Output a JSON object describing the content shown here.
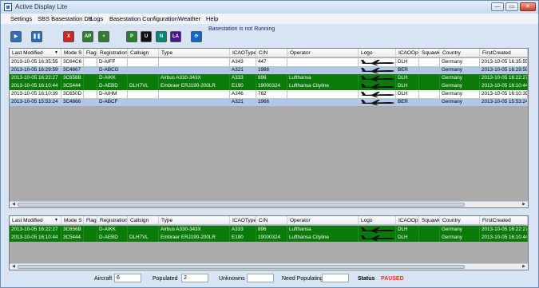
{
  "window": {
    "title": "Active Display Lite",
    "buttons": [
      "—",
      "▭",
      "✕"
    ]
  },
  "menu": [
    "Settings",
    "SBS Basestation DB",
    "Logs",
    "Basestation Configuration",
    "Weather",
    "Help"
  ],
  "toolbar": {
    "status_message": "Basestation is not Running",
    "buttons": [
      {
        "name": "start",
        "label": "▶",
        "color": "#2f6db5"
      },
      {
        "name": "pause",
        "label": "❚❚",
        "color": "#2f6db5"
      },
      {
        "name": "delete",
        "label": "X",
        "color": "#c62828"
      },
      {
        "name": "ap",
        "label": "AP",
        "color": "#2e7d32"
      },
      {
        "name": "add",
        "label": "+",
        "color": "#2e7d32"
      },
      {
        "name": "p",
        "label": "P",
        "color": "#2e7d32"
      },
      {
        "name": "u",
        "label": "U",
        "color": "#111111"
      },
      {
        "name": "n",
        "label": "N",
        "color": "#00897b"
      },
      {
        "name": "la",
        "label": "LA",
        "color": "#4a148c"
      },
      {
        "name": "refresh",
        "label": "⟳",
        "color": "#1565c0"
      }
    ]
  },
  "columns": [
    "Last Modified",
    "Mode S",
    "Flag",
    "Registration",
    "Callsign",
    "Type",
    "ICAOType",
    "C/N",
    "Operator",
    "Logo",
    "ICAOOp",
    "Squawk",
    "Country",
    "FirstCreated"
  ],
  "sort_indicator": "▼",
  "top_rows": [
    {
      "style": "white",
      "cells": [
        "2013-10-05 16:35:55",
        "3C64C6",
        "",
        "D-AIFF",
        "",
        "",
        "A343",
        "447",
        "",
        "",
        "DLH",
        "",
        "Germany",
        "2013-10-05 16:35:55"
      ]
    },
    {
      "style": "blue",
      "cells": [
        "2013-10-05 16:29:59",
        "3C4867",
        "",
        "D-ABCG",
        "",
        "",
        "A321",
        "1988",
        "",
        "",
        "BER",
        "",
        "Germany",
        "2013-10-05 16:29:59"
      ]
    },
    {
      "style": "green",
      "cells": [
        "2013-10-05 16:22:27",
        "3C656B",
        "",
        "D-AIKK",
        "",
        "Airbus A330-343X",
        "A333",
        "896",
        "Lufthansa",
        "",
        "DLH",
        "",
        "Germany",
        "2013-10-05 16:22:27"
      ]
    },
    {
      "style": "green",
      "cells": [
        "2013-10-05 16:10:44",
        "3C5444",
        "",
        "D-AEBD",
        "DLH7VL",
        "Embraer ERJ190-200LR",
        "E190",
        "19000324",
        "Lufthansa Cityline",
        "",
        "DLH",
        "",
        "Germany",
        "2013-10-05 16:10:44"
      ]
    },
    {
      "style": "white",
      "cells": [
        "2013-10-05 16:10:39",
        "3C650D",
        "",
        "D-AIHM",
        "",
        "",
        "A346",
        "762",
        "",
        "",
        "DLH",
        "",
        "Germany",
        "2013-10-05 16:10:39"
      ]
    },
    {
      "style": "blue",
      "cells": [
        "2013-10-05 15:53:24",
        "3C4866",
        "",
        "D-ABCF",
        "",
        "",
        "A321",
        "1966",
        "",
        "",
        "BER",
        "",
        "Germany",
        "2013-10-05 15:53:24"
      ]
    }
  ],
  "bottom_rows": [
    {
      "style": "green",
      "cells": [
        "2013-10-05 16:22:27",
        "3C656B",
        "",
        "D-AIKK",
        "",
        "Airbus A330-343X",
        "A333",
        "896",
        "Lufthansa",
        "",
        "DLH",
        "",
        "Germany",
        "2013-10-05 16:22:27"
      ]
    },
    {
      "style": "green",
      "cells": [
        "2013-10-05 16:10:44",
        "3C5444",
        "",
        "D-AEBD",
        "DLH7VL",
        "Embraer ERJ190-200LR",
        "E190",
        "19000324",
        "Lufthansa Cityline",
        "",
        "DLH",
        "",
        "Germany",
        "2013-10-05 16:10:44"
      ]
    }
  ],
  "footer": {
    "aircraft_label": "Aircraft",
    "aircraft_value": "6",
    "populated_label": "Populated",
    "populated_value": "2",
    "unknowns_label": "Unknowns",
    "unknowns_value": "",
    "need_populating_label": "Need Populating",
    "need_populating_value": "",
    "status_label": "Status",
    "status_value": "PAUSED"
  }
}
